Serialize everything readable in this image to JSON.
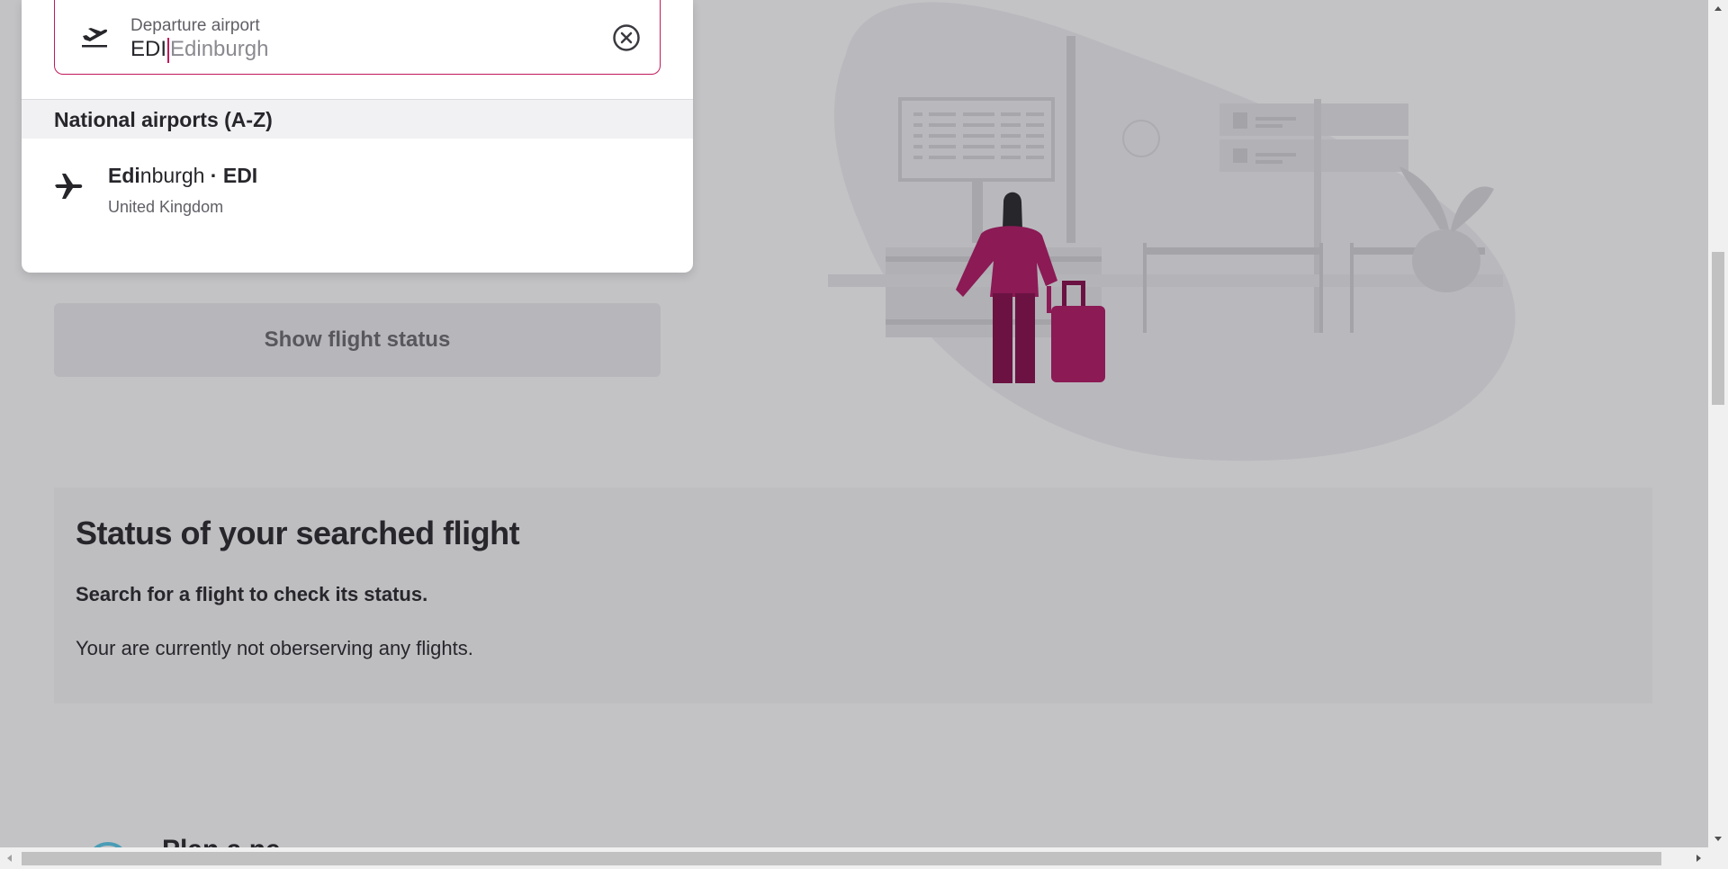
{
  "departure_field": {
    "label": "Departure airport",
    "typed_value": "EDI",
    "autocomplete_suffix": "Edinburgh",
    "accent_color": "#c2185b"
  },
  "airport_dropdown": {
    "group_header": "National airports (A-Z)",
    "options": [
      {
        "name_match": "Edi",
        "name_rest": "nburgh",
        "separator": " · ",
        "code": "EDI",
        "country": "United Kingdom",
        "icon": "airplane-icon"
      }
    ]
  },
  "show_status_button": {
    "label": "Show flight status"
  },
  "status_section": {
    "title": "Status of your searched flight",
    "subtitle": "Search for a flight to check its status.",
    "note": "Your are currently not oberserving any flights."
  },
  "next_section_peek": {
    "title": "Plan a ne"
  },
  "colors": {
    "overlay_background": "#c3c3c6",
    "brand": "#8b1a55"
  }
}
